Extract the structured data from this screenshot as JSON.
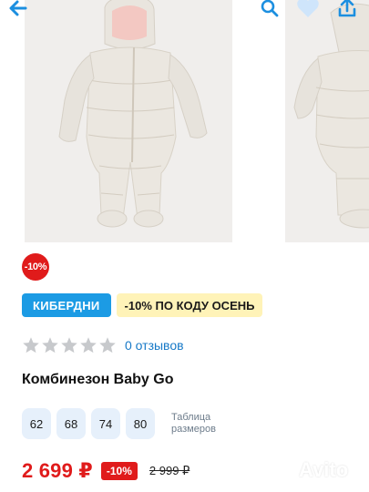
{
  "header": {
    "back_icon": "arrow-left-icon",
    "search_icon": "search-icon",
    "favorite_icon": "heart-icon",
    "share_icon": "share-icon"
  },
  "gallery": {
    "images": [
      "snowsuit-front-photo",
      "snowsuit-side-photo"
    ]
  },
  "discount_badge": {
    "label": "-10%"
  },
  "promo": {
    "tag_label": "КИБЕРДНИ",
    "code_label": "-10% ПО КОДУ ОСЕНЬ"
  },
  "rating": {
    "stars_total": 5,
    "stars_filled": 0,
    "reviews_label": "0 отзывов"
  },
  "product": {
    "title": "Комбинезон Baby Go"
  },
  "sizes": {
    "options": [
      "62",
      "68",
      "74",
      "80"
    ],
    "table_label": "Таблица размеров"
  },
  "pricing": {
    "price": "2 699 ₽",
    "discount": "-10%",
    "old_price": "2 999 ₽"
  },
  "watermark": {
    "text": "Avito"
  },
  "colors": {
    "accent_blue": "#1c9be4",
    "sale_red": "#e01b1b",
    "promo_yellow": "#fff3b8",
    "size_chip": "#e6f0fb",
    "link_blue": "#1779c7"
  }
}
